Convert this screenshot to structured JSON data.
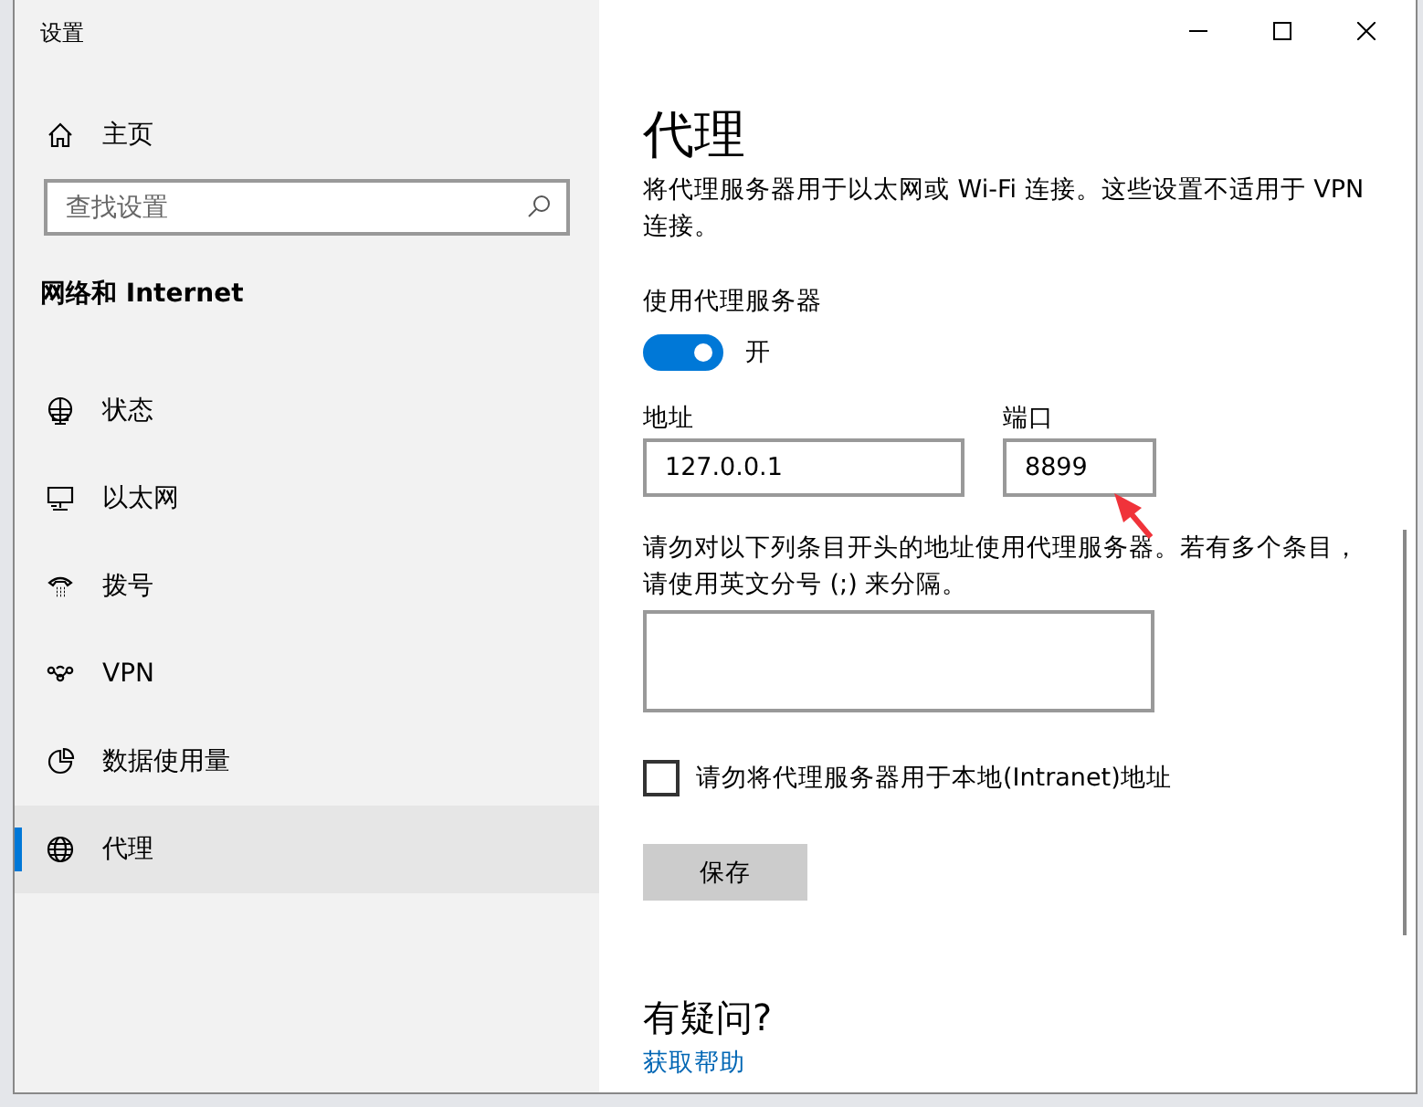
{
  "window": {
    "title": "设置"
  },
  "sidebar": {
    "home": "主页",
    "search": {
      "placeholder": "查找设置"
    },
    "section": "网络和 Internet",
    "items": [
      {
        "label": "状态",
        "selected": false
      },
      {
        "label": "以太网",
        "selected": false
      },
      {
        "label": "拨号",
        "selected": false
      },
      {
        "label": "VPN",
        "selected": false
      },
      {
        "label": "数据使用量",
        "selected": false
      },
      {
        "label": "代理",
        "selected": true
      }
    ]
  },
  "content": {
    "title": "代理",
    "description": "将代理服务器用于以太网或 Wi-Fi 连接。这些设置不适用于 VPN 连接。",
    "proxy": {
      "label": "使用代理服务器",
      "on": true,
      "state_text": "开"
    },
    "address": {
      "label": "地址",
      "value": "127.0.0.1"
    },
    "port": {
      "label": "端口",
      "value": "8899"
    },
    "exceptions_note": "请勿对以下列条目开头的地址使用代理服务器。若有多个条目，请使用英文分号 (;) 来分隔。",
    "local_bypass": {
      "label": "请勿将代理服务器用于本地(Intranet)地址",
      "checked": false
    },
    "save_button": "保存",
    "help": {
      "title": "有疑问?",
      "link": "获取帮助"
    }
  }
}
